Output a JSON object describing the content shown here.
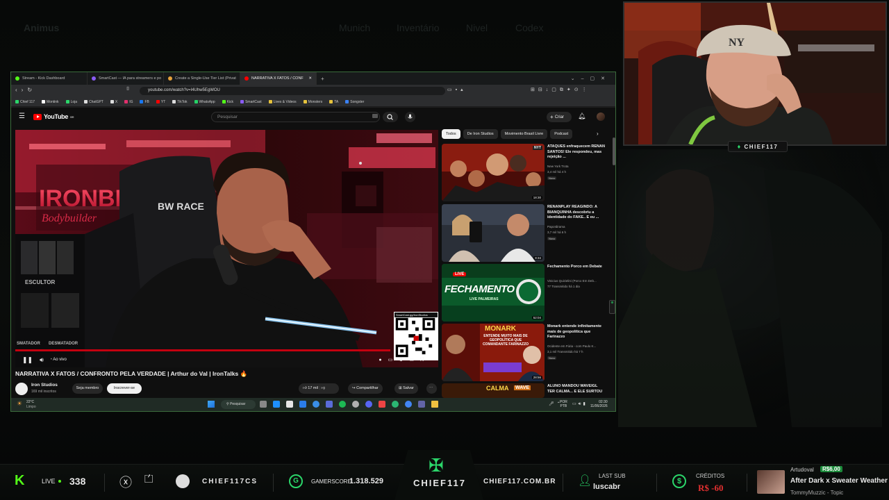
{
  "game_menu": {
    "title": "Animus",
    "items": [
      "Munich",
      "Inventário",
      "Nivel",
      "Codex"
    ]
  },
  "browser": {
    "tabs": [
      {
        "label": "Stream - Kick Dashboard",
        "color": "#53fc18"
      },
      {
        "label": "SmartCast — IA para streamers e po",
        "color": "#8a5cf6"
      },
      {
        "label": "Create a Single-Use Tier List (Privat",
        "color": "#e6a23c"
      },
      {
        "label": "NARRATIVA X FATOS / CONF",
        "color": "#ff0000",
        "active": true
      }
    ],
    "url": "youtube.com/watch?v=I4Uhw5EgWOU",
    "bookmarks": [
      {
        "label": "Chief 117",
        "color": "#2bd66a"
      },
      {
        "label": "Montink",
        "color": "#ffffff"
      },
      {
        "label": "Loja",
        "color": "#2bd66a"
      },
      {
        "label": "ChatGPT",
        "color": "#dddddd"
      },
      {
        "label": "X",
        "color": "#dddddd"
      },
      {
        "label": "IG",
        "color": "#e1306c"
      },
      {
        "label": "FB",
        "color": "#1877f2"
      },
      {
        "label": "YT",
        "color": "#ff0000"
      },
      {
        "label": "TikTok",
        "color": "#dddddd"
      },
      {
        "label": "WhatsApp",
        "color": "#25d366"
      },
      {
        "label": "Kick",
        "color": "#53fc18"
      },
      {
        "label": "SmartCast",
        "color": "#8a5cf6"
      },
      {
        "label": "Lives & Videos",
        "color": "#e6c23c"
      },
      {
        "label": "Monsters",
        "color": "#e6c23c"
      },
      {
        "label": "TA",
        "color": "#e6c23c"
      },
      {
        "label": "Songster",
        "color": "#3b82f6"
      }
    ]
  },
  "youtube": {
    "logo": "YouTube",
    "country": "BR",
    "search_placeholder": "Pesquisar",
    "create_label": "Criar",
    "video": {
      "title": "NARRATIVA X FATOS / CONFRONTO PELA VERDADE | Arthur do Val | IronTalks 🔥",
      "live_label": "Ao vivo",
      "qr_caption": "SmartCast.gg/IronStudios",
      "sign_text": "IRONBE",
      "sign_sub": "Bodybuilder",
      "chair_text": "BW RACE",
      "shelf_text_1": "ESCULTOR",
      "shelf_text_2": "DESMATADOR",
      "shelf_text_3": "SMATADOR"
    },
    "channel": {
      "name": "Iron Studios",
      "subs": "169 mil inscritos",
      "member_label": "Seja membro",
      "subscribe_label": "Inscrever-se"
    },
    "actions": {
      "likes": "17 mil",
      "share": "Compartilhar",
      "save": "Salvar"
    },
    "chips": [
      "Todos",
      "De Iron Studios",
      "Movimento Brasil Livre",
      "Podcast"
    ],
    "recommendations": [
      {
        "title": "ATAQUES enfraquecem RENAN SANTOS! Ele respondeu, mas rejeição ...",
        "channel": "New York Trota",
        "views": "3,4 mil  há 4 h",
        "duration": "18:30",
        "badge": "Novo",
        "corner": "NYT"
      },
      {
        "title": "RENANPLAY REAGINDO: A BIANQUINHA descobriu a identidade do FAKE.. E eu ...",
        "channel": "Papo!dirama",
        "views": "3,7 mil  há 6 h",
        "duration": "8:34",
        "badge": "Novo"
      },
      {
        "title": "Fechamento Porco em Debate",
        "channel": "Vinicius Quizielini (Porco Em Deb...",
        "views": "77  Transmitido há 1 dia",
        "duration": "52:04",
        "thumb_text": "FECHAMENTO",
        "thumb_sub": "LIVE PALMEIRAS",
        "live": "LIVE"
      },
      {
        "title": "Monark entende infinitamente mais de geopolítica que Farinazzo",
        "channel": "Ocidente em Fúria - com Paulo K...",
        "views": "3,1 mil  Transmitido há 7 h",
        "duration": "28:56",
        "badge": "Novo",
        "thumb_text": "MONARK",
        "thumb_sub": "ENTENDE MUITO MAIS DE GEOPOLÍTICA QUE COMANDANTE FARINAZZO"
      },
      {
        "title": "ALUNO MANDOU WAVEIGL TER CALMA... E ELE SURTOU",
        "thumb_text": "CALMA",
        "thumb_sub": "WAVE"
      }
    ]
  },
  "taskbar": {
    "weather_temp": "22°C",
    "weather_desc": "Limpo",
    "search": "Pesquisar",
    "lang": "POR",
    "layout": "PTB",
    "time": "02:30",
    "date": "11/06/2026"
  },
  "webcam": {
    "tag": "CHIEF117"
  },
  "bottom_bar": {
    "live_label": "LIVE",
    "viewers": "338",
    "handle": "CHIEF117CS",
    "gamerscore_label": "GAMERSCORE",
    "gamerscore": "1.318.529",
    "brand": "CHIEF117",
    "site": "CHIEF117.COM.BR",
    "last_sub_label": "LAST SUB",
    "last_sub": "luscabr",
    "credits_label": "CRÉDITOS",
    "credits": "R$ -60",
    "donor": "Artudoval",
    "donation": "R$6,00",
    "song": "After Dark x Sweater Weather",
    "song_artist": "TommyMuzzic - Topic"
  },
  "colors": {
    "accent": "#53fc18",
    "yt_red": "#ff0000",
    "brand_green": "#2bd66a"
  }
}
